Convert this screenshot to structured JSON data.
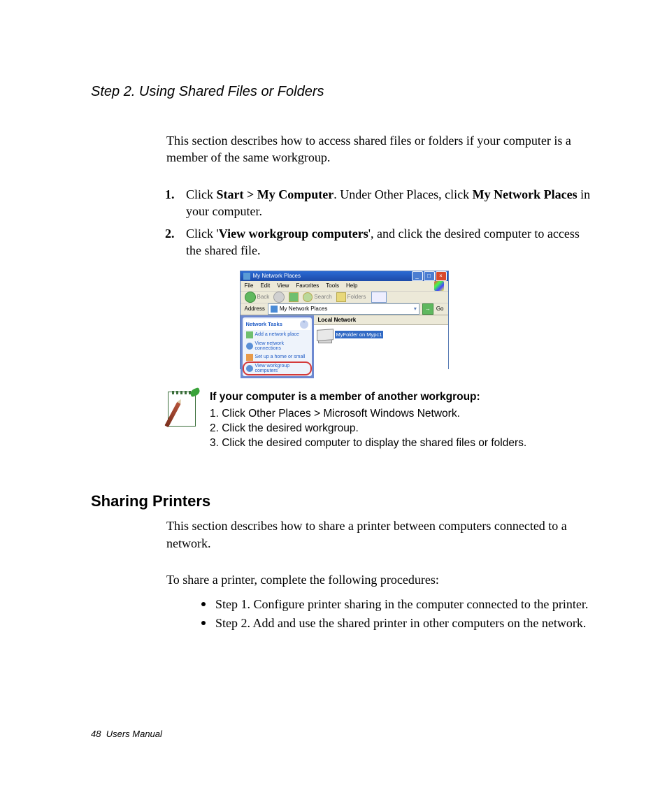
{
  "headings": {
    "step2": "Step 2. Using Shared Files or Folders",
    "sharingPrinters": "Sharing Printers"
  },
  "paragraphs": {
    "intro": "This section describes how to access shared files or folders if your computer is a member of the same workgroup.",
    "printersIntro": "This section describes how to share a printer between computers connected to a network.",
    "printersLead": "To share a printer, complete the following procedures:"
  },
  "steps": {
    "s1": {
      "num": "1.",
      "pre": "Click ",
      "b1": "Start > My Computer",
      "mid": ". Under Other Places, click ",
      "b2": "My Network Places",
      "post": " in your computer."
    },
    "s2": {
      "num": "2.",
      "pre": "Click '",
      "b1": "View workgroup computers",
      "post": "', and click the desired computer to access the shared file."
    }
  },
  "screenshot": {
    "title": "My Network Places",
    "menu": {
      "file": "File",
      "edit": "Edit",
      "view": "View",
      "favorites": "Favorites",
      "tools": "Tools",
      "help": "Help"
    },
    "toolbar": {
      "back": "Back",
      "search": "Search",
      "folders": "Folders"
    },
    "addressLabel": "Address",
    "addressValue": "My Network Places",
    "goLabel": "Go",
    "tasksHeader": "Network Tasks",
    "tasks": {
      "add": "Add a network place",
      "view": "View network connections",
      "setup": "Set up a home or small",
      "workgroup": "View workgroup computers"
    },
    "mainHeader": "Local Network",
    "itemLabel": "MyFolder on Mypc1"
  },
  "note": {
    "head": "If your computer is a member of another workgroup:",
    "l1": "1. Click Other Places > Microsoft Windows Network.",
    "l2": "2. Click the desired workgroup.",
    "l3": "3. Click the desired computer to display the shared files or folders."
  },
  "bullets": {
    "b1": "Step 1. Configure printer sharing in the computer connected to the printer.",
    "b2": "Step 2. Add and use the shared printer in other computers on the network."
  },
  "footer": {
    "page": "48",
    "label": "Users Manual"
  }
}
